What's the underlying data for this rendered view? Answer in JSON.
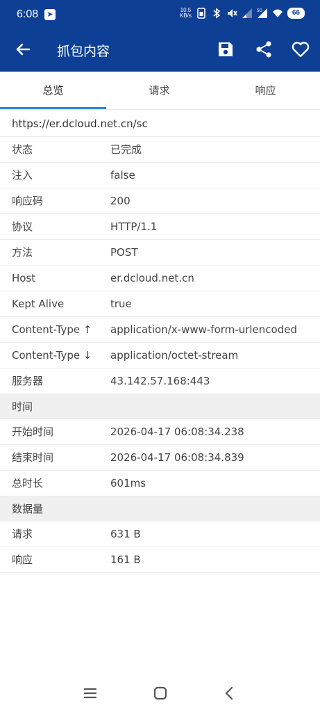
{
  "status_bar": {
    "time": "6:08",
    "net_speed_value": "10.5",
    "net_speed_unit": "KB/s",
    "battery": "66",
    "icons": [
      "telegram-icon",
      "sim-icon",
      "bluetooth-icon",
      "mute-icon",
      "signal-icon",
      "signal-5g-icon",
      "wifi-icon",
      "battery-icon"
    ]
  },
  "app_bar": {
    "title": "抓包内容",
    "icons": [
      "back-arrow-icon",
      "save-icon",
      "share-icon",
      "heart-icon"
    ],
    "background_color": "#0d3f95"
  },
  "tabs": [
    {
      "label": "总览",
      "active": true
    },
    {
      "label": "请求",
      "active": false
    },
    {
      "label": "响应",
      "active": false
    }
  ],
  "accent_color": "#2a87d3",
  "overview": {
    "url": "https://er.dcloud.net.cn/sc",
    "fields": [
      {
        "key": "状态",
        "value": "已完成"
      },
      {
        "key": "注入",
        "value": "false"
      },
      {
        "key": "响应码",
        "value": "200"
      },
      {
        "key": "协议",
        "value": "HTTP/1.1"
      },
      {
        "key": "方法",
        "value": "POST"
      },
      {
        "key": "Host",
        "value": "er.dcloud.net.cn"
      },
      {
        "key": "Kept Alive",
        "value": "true"
      },
      {
        "key": "Content-Type ↑",
        "value": "application/x-www-form-urlencoded"
      },
      {
        "key": "Content-Type ↓",
        "value": "application/octet-stream"
      },
      {
        "key": "服务器",
        "value": "43.142.57.168:443"
      }
    ],
    "time_section": {
      "title": "时间",
      "fields": [
        {
          "key": "开始时间",
          "value": "2026-04-17 06:08:34.238"
        },
        {
          "key": "结束时间",
          "value": "2026-04-17 06:08:34.839"
        },
        {
          "key": "总时长",
          "value": "601ms"
        }
      ]
    },
    "data_section": {
      "title": "数据量",
      "fields": [
        {
          "key": "请求",
          "value": "631 B"
        },
        {
          "key": "响应",
          "value": "161 B"
        }
      ]
    }
  },
  "nav_bar": {
    "icons": [
      "menu-icon",
      "home-icon",
      "back-icon"
    ]
  }
}
